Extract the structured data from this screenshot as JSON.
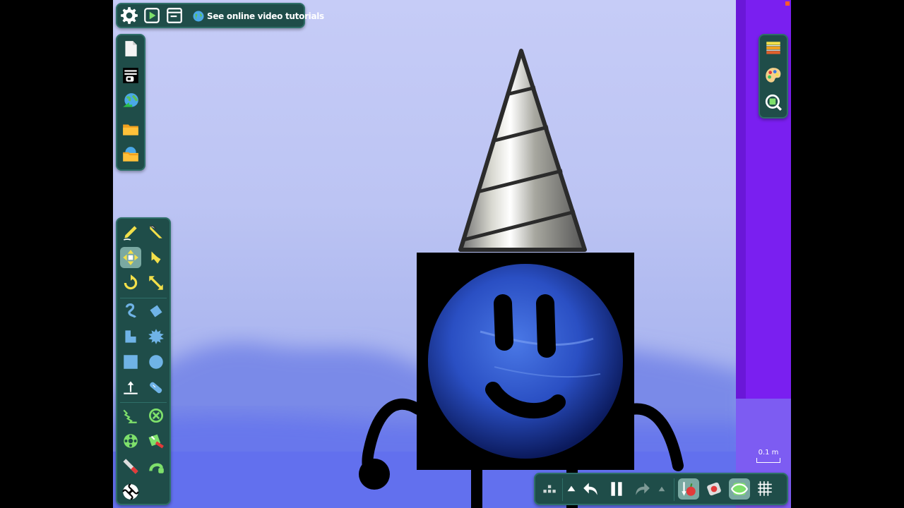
{
  "top_bar": {
    "tutorial_label": "See online video tutorials"
  },
  "scale": {
    "label": "0.1 m"
  },
  "colors": {
    "panel": "#1f4d49",
    "panel_border": "#2f6f69",
    "active_tool": "#7aa9a2",
    "background": "#c6ccf7",
    "purple_wall": "#7a1ff0",
    "planet_blue": "#2e55c8"
  },
  "icons": {
    "top_bar": [
      "settings-icon",
      "play-icon",
      "window-icon",
      "globe-icon"
    ],
    "file_panel": [
      "new-scene-icon",
      "scene-options-icon",
      "save-icon",
      "open-icon",
      "browse-online-icon"
    ],
    "tools": [
      "sketch-icon",
      "knife-icon",
      "move-icon",
      "drag-icon",
      "rotate-icon",
      "scale-icon",
      "rope-icon",
      "eraser-icon",
      "polygon-icon",
      "gear-icon",
      "box-icon",
      "circle-icon",
      "plane-icon",
      "chain-icon",
      "spring-icon",
      "fixate-icon",
      "axle-icon",
      "tracer-icon",
      "laser-icon",
      "thruster-icon",
      "swirl-icon"
    ],
    "right_panel": [
      "layers-icon",
      "palette-icon",
      "zoom-icon"
    ],
    "bottom_bar": [
      "menu-dots-icon",
      "undo-expand-icon",
      "undo-icon",
      "pause-icon",
      "redo-icon",
      "redo-expand-icon",
      "gravity-icon",
      "camera-icon",
      "track-icon",
      "grid-icon"
    ]
  }
}
